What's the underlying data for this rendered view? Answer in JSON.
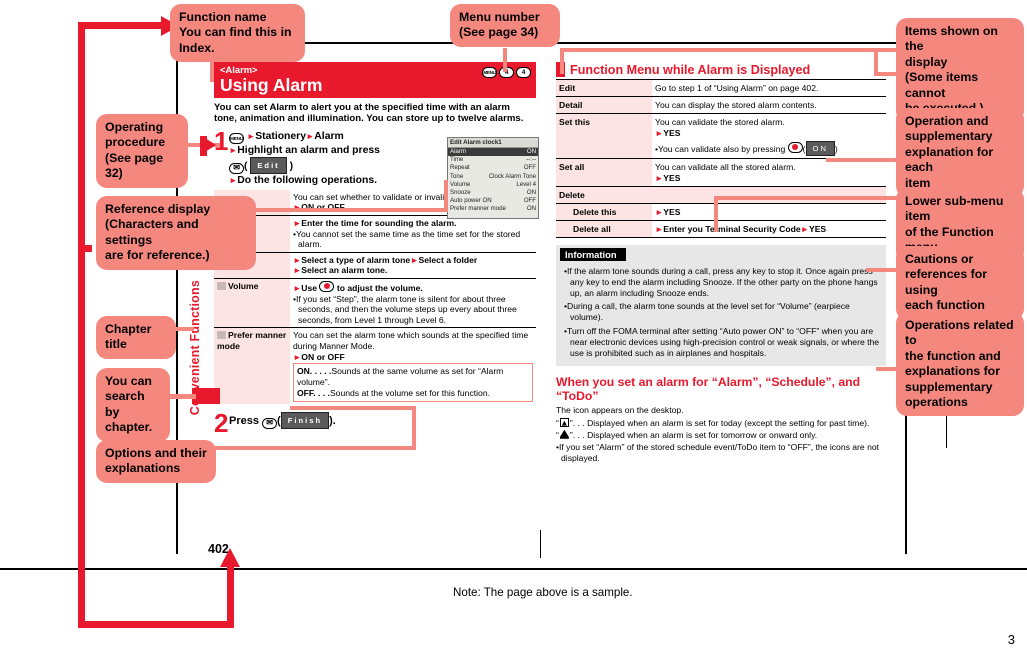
{
  "document": {
    "page_number": "402",
    "corner_number": "3",
    "note": "Note: The page above is a sample.",
    "chapter_title": "Convenient Functions"
  },
  "callouts": {
    "left": [
      {
        "id": "function-name",
        "text": "Function name\nYou can find this in\nIndex."
      },
      {
        "id": "operating-procedure",
        "text": "Operating\nprocedure\n(See page 32)"
      },
      {
        "id": "reference-display",
        "text": "Reference display\n(Characters and settings\nare for reference.)"
      },
      {
        "id": "chapter-title",
        "text": "Chapter title"
      },
      {
        "id": "search-by-chapter",
        "text": "You can\nsearch by\nchapter."
      },
      {
        "id": "options-explanations",
        "text": "Options and their\nexplanations"
      }
    ],
    "top": [
      {
        "id": "menu-number",
        "text": "Menu number\n(See page 34)"
      }
    ],
    "right": [
      {
        "id": "items-shown",
        "text": "Items shown on the\ndisplay\n(Some items cannot\nbe executed.)"
      },
      {
        "id": "operation-supplementary",
        "text": "Operation and\nsupplementary\nexplanation for each\nitem"
      },
      {
        "id": "lower-sub-menu",
        "text": "Lower sub-menu item\nof the Function menu"
      },
      {
        "id": "cautions-references",
        "text": "Cautions or\nreferences for using\neach function"
      },
      {
        "id": "operations-related",
        "text": "Operations related to\nthe function and\nexplanations for\nsupplementary\noperations"
      }
    ]
  },
  "article": {
    "subtitle": "<Alarm>",
    "title": "Using Alarm",
    "menu_keys": [
      "MENU",
      "4",
      "4"
    ],
    "intro": "You can set Alarm to alert you at the specified time with an alarm tone, animation and illumination. You can store up to twelve alarms.",
    "step1": {
      "number": "1",
      "line1_menu_key": "MENU",
      "line1": "Stationery",
      "line1b": "Alarm",
      "line2": "Highlight an alarm and press",
      "line3_key": "Edit",
      "line4": "Do the following operations."
    },
    "step2": {
      "number": "2",
      "label": "Press",
      "softkey": "Finish",
      "suffix": ")."
    },
    "phone_screen": {
      "title": "Edit Alarm clock1",
      "rows": [
        {
          "label": "Alarm",
          "value": "ON",
          "selected": true
        },
        {
          "label": "Time",
          "value": "--:--",
          "selected": false
        },
        {
          "label": "Repeat",
          "value": "OFF",
          "selected": false
        },
        {
          "label": "Tone",
          "value": "Clock Alarm Tone",
          "selected": false
        },
        {
          "label": "Volume",
          "value": "Level 4",
          "selected": false
        },
        {
          "label": "Snooze",
          "value": "ON",
          "selected": false
        },
        {
          "label": "Auto power ON",
          "value": "OFF",
          "selected": false
        },
        {
          "label": "Prefer manner mode",
          "value": "ON",
          "selected": false
        }
      ]
    },
    "options": [
      {
        "name": "",
        "lines": [
          {
            "type": "text",
            "text": "You can set whether to validate or invalidate the alarm."
          },
          {
            "type": "arrow-bold",
            "text": "ON or OFF"
          }
        ]
      },
      {
        "name": "Time",
        "lines": [
          {
            "type": "arrow-bold",
            "text": "Enter the time for sounding the alarm."
          },
          {
            "type": "bullet",
            "text": "You cannot set the same time as the time set for the stored alarm."
          }
        ]
      },
      {
        "name": "Tone",
        "lines": [
          {
            "type": "arrow-bold",
            "text": "Select a type of alarm tone"
          },
          {
            "type": "arrow-bold-cont",
            "text": "Select a folder"
          },
          {
            "type": "arrow-bold",
            "text": "Select an alarm tone."
          }
        ]
      },
      {
        "name": "Volume",
        "lines": [
          {
            "type": "arrow-bold-key",
            "text": "Use",
            "text2": "to adjust the volume."
          },
          {
            "type": "bullet",
            "text": "If you set “Step”, the alarm tone is silent for about three seconds, and then the volume steps up every about three seconds, from Level 1 through Level 6."
          }
        ]
      },
      {
        "name": "Prefer manner mode",
        "lines": [
          {
            "type": "text",
            "text": "You can set the alarm tone which sounds at the specified time during Manner Mode."
          },
          {
            "type": "arrow-bold",
            "text": "ON or OFF"
          }
        ],
        "note_box": [
          {
            "bold": "ON",
            "dots": ". . . . .",
            "text": "Sounds at the same volume as set for “Alarm volume”."
          },
          {
            "bold": "OFF",
            "dots": ". . . .",
            "text": "Sounds at the volume set for this function."
          }
        ]
      }
    ]
  },
  "function_menu": {
    "heading": "Function Menu while Alarm is Displayed",
    "rows": [
      {
        "key": "Edit",
        "value": "Go to step 1 of “Using Alarm” on page 402.",
        "sub": false
      },
      {
        "key": "Detail",
        "value": "You can display the stored alarm contents.",
        "sub": false
      },
      {
        "key": "Set this",
        "value": "You can validate the stored alarm.",
        "arrow": "YES",
        "bullet_key": "You can validate also by pressing",
        "bullet_softkey": "ON",
        "sub": false
      },
      {
        "key": "Set all",
        "value": "You can validate all the stored alarm.",
        "arrow": "YES",
        "sub": false
      },
      {
        "key": "Delete",
        "value": "",
        "sub": false
      },
      {
        "key": "Delete this",
        "value": "",
        "arrow": "YES",
        "sub": true
      },
      {
        "key": "Delete all",
        "value": "",
        "arrow": "Enter you Terminal Security Code",
        "arrow2": "YES",
        "sub": true
      }
    ]
  },
  "information": {
    "heading": "Information",
    "items": [
      "If the alarm tone sounds during a call, press any key to stop it. Once again press any key to end the alarm including Snooze. If the other party on the phone hangs up, an alarm including Snooze ends.",
      "During a call, the alarm tone sounds at the level set for “Volume” (earpiece volume).",
      "Turn off the FOMA terminal after setting “Auto power ON” to “OFF” when you are near electronic devices using high-precision control or weak signals, or where the use is prohibited such as in airplanes and hospitals."
    ]
  },
  "alarm_section": {
    "heading": "When you set an alarm for “Alarm”, “Schedule”, and “ToDo”",
    "intro": "The icon appears on the desktop.",
    "icon_lines": [
      {
        "icon": "alarm-clock-icon",
        "text": ". . . Displayed when an alarm is set for today (except the setting for past time)."
      },
      {
        "icon": "bell-icon",
        "text": ". . . Displayed when an alarm is set for tomorrow or onward only."
      }
    ],
    "bullet": "If you set “Alarm” of the stored schedule event/ToDo item to “OFF”, the icons are not displayed."
  },
  "colors": {
    "accent_red": "#e8192c",
    "bubble_pink": "#f4877e",
    "table_pink": "#fbe4e3",
    "info_gray": "#e7e7e7"
  }
}
